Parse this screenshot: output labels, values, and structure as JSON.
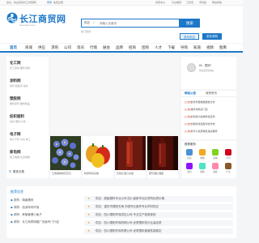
{
  "topbar": {
    "welcome": "您好，欢迎来到长江商贸网！",
    "login": "登录",
    "register": "免费注册",
    "links": [
      "商家中心",
      "平台规则",
      "工作室",
      "手机版",
      "网站导航"
    ]
  },
  "header": {
    "logo_text": "长江商贸网",
    "logo_sub": "www.cjsm.com",
    "search_type": "供应",
    "search_placeholder": "请输入关键词",
    "search_button": "搜索",
    "hot_label": "热门搜索：",
    "publish_supply": "发布供应",
    "publish_buy": "发布求购"
  },
  "nav": {
    "items": [
      "首页",
      "商城",
      "供应",
      "求购",
      "公司",
      "资讯",
      "行情",
      "展会",
      "品牌",
      "招商",
      "团购",
      "人才",
      "下载",
      "导购",
      "知道",
      "视频",
      "图库"
    ]
  },
  "categories": [
    {
      "title": "化工网",
      "subs": "化工原料  塑料  颜料"
    },
    {
      "title": "涂料网",
      "subs": "涂料  胶粘剂  油墨"
    },
    {
      "title": "塑胶网",
      "subs": "塑料原料  塑料制品"
    },
    {
      "title": "纺织面料",
      "subs": "纺织  面料  纱线"
    },
    {
      "title": "电子网",
      "subs": "电子元件  仪表  电工"
    },
    {
      "title": "家电网",
      "subs": "厨卫电器  生活电器"
    }
  ],
  "more_categories": "更多分类",
  "user": {
    "hello": "Hi，您好！",
    "welcome": "欢迎来到本站"
  },
  "notice": {
    "tabs": [
      "网站公告",
      "商贸资讯"
    ],
    "items": [
      {
        "tag": "[公告]",
        "text": "前景增量数据报告分析"
      },
      {
        "tag": "[公告]",
        "text": "重庆市网点门店"
      },
      {
        "tag": "[公告]",
        "text": "如何成为某物料供应商"
      },
      {
        "tag": "[公告]",
        "text": "长期寻找铝型材合作商"
      },
      {
        "tag": "[公告]",
        "text": "有什么优质销售渠道推荐"
      }
    ]
  },
  "products": [
    {
      "name": "云南美味鲜花花卉"
    },
    {
      "name": "新鲜有机彩椒"
    },
    {
      "name": "高档红酒小彩瓶"
    },
    {
      "name": "葡萄酒红酒瓶"
    }
  ],
  "quick": {
    "title": "推荐服务",
    "items": [
      {
        "label": "供应",
        "color": "#4a90d9"
      },
      {
        "label": "求购",
        "color": "#f5a623"
      },
      {
        "label": "商城",
        "color": "#7ed321"
      },
      {
        "label": "公司",
        "color": "#d0021b"
      },
      {
        "label": "资讯",
        "color": "#9013fe"
      },
      {
        "label": "团购",
        "color": "#50e3c2"
      },
      {
        "label": "展会",
        "color": "#f8a"
      },
      {
        "label": "广告",
        "color": "#8b572a"
      }
    ]
  },
  "bottom": {
    "title": "推荐信息",
    "left": [
      "求购：湖南猪肉",
      "求购：泡沫砖块环保",
      "求购：养殖管理小兔子",
      "求购：长江商贸网推广页面专门介绍"
    ],
    "right": [
      "供应：超级塑料专业公司 四川省新华社区采购优质价格",
      "供应：重庆市德阳天海 中国专业医药专业药材供应",
      "供应：四川德阳环保供应公司 专业生产各类家用",
      "供应：四川德阳环保机械公司 优质塑料性价比高品质",
      "供应：四川德阳环保有限公司 优质塑料管道性能稳定"
    ]
  }
}
